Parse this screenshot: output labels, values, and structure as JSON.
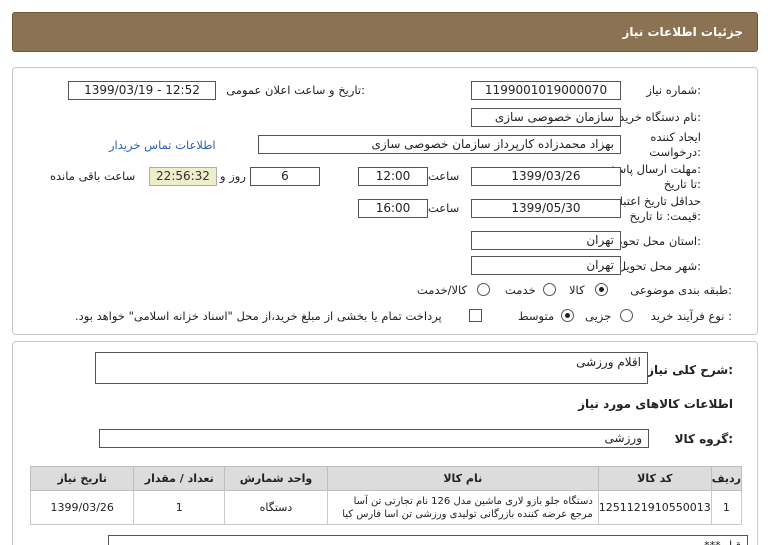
{
  "header": {
    "title": "جزئیات اطلاعات نیاز"
  },
  "form": {
    "need_number_label": "شماره نیاز:",
    "need_number": "1199001019000070",
    "announce_label": "تاریخ و ساعت اعلان عمومی:",
    "announce_value": "1399/03/19 - 12:52",
    "buyer_org_label": "نام دستگاه خریدار:",
    "buyer_org": "سازمان خصوصی سازی",
    "creator_label_1": "ایجاد کننده",
    "creator_label_2": "درخواست:",
    "creator": "بهزاد محمدزاده کارپرداز سازمان خصوصی سازی",
    "contact_link": "اطلاعات تماس خریدار",
    "deadline_label_1": "مهلت ارسال پاسخ:",
    "deadline_label_2": "تا تاریخ:",
    "deadline_date": "1399/03/26",
    "time_label": "ساعت",
    "deadline_time": "12:00",
    "days_value": "6",
    "days_label": "روز و",
    "remaining_time": "22:56:32",
    "remaining_label": "ساعت باقی مانده",
    "validity_label_1": "حداقل تاریخ اعتبار",
    "validity_label_2": "قیمت: تا تاریخ:",
    "validity_date": "1399/05/30",
    "validity_time": "16:00",
    "province_label": "استان محل تحویل:",
    "province": "تهران",
    "city_label": "شهر محل تحویل:",
    "city": "تهران",
    "category_label": "طبقه بندی موضوعی:",
    "category_options": [
      "کالا",
      "خدمت",
      "کالا/خدمت"
    ],
    "category_selected": "کالا",
    "process_label": "نوع فرآیند خرید :",
    "process_options": [
      "جزیی",
      "متوسط"
    ],
    "process_selected": "متوسط",
    "payment_note": "پرداخت تمام یا بخشی از مبلغ خرید،از محل \"اسناد خزانه اسلامی\" خواهد بود."
  },
  "details": {
    "summary_label": "شرح کلی نیاز:",
    "summary": "اقلام  ورزشی",
    "goods_info_title": "اطلاعات کالاهای مورد نیاز",
    "goods_group_label": "گروه کالا:",
    "goods_group": "ورزشی",
    "table": {
      "headers": [
        "ردیف",
        "کد کالا",
        "نام کالا",
        "واحد شمارش",
        "تعداد / مقدار",
        "تاریخ نیاز"
      ],
      "rows": [
        {
          "row": "1",
          "code": "1251121910550013",
          "name_line1": "دستگاه جلو بازو لاری ماشین مدل 126 نام تجارتی تن آسا",
          "name_line2": "مرجع عرضه کننده بازرگانی تولیدی ورزشی تن اسا فارس کیا",
          "unit": "دستگاه",
          "qty": "1",
          "date": "1399/03/26"
        }
      ]
    },
    "footer_text": "قبل  ***  "
  }
}
